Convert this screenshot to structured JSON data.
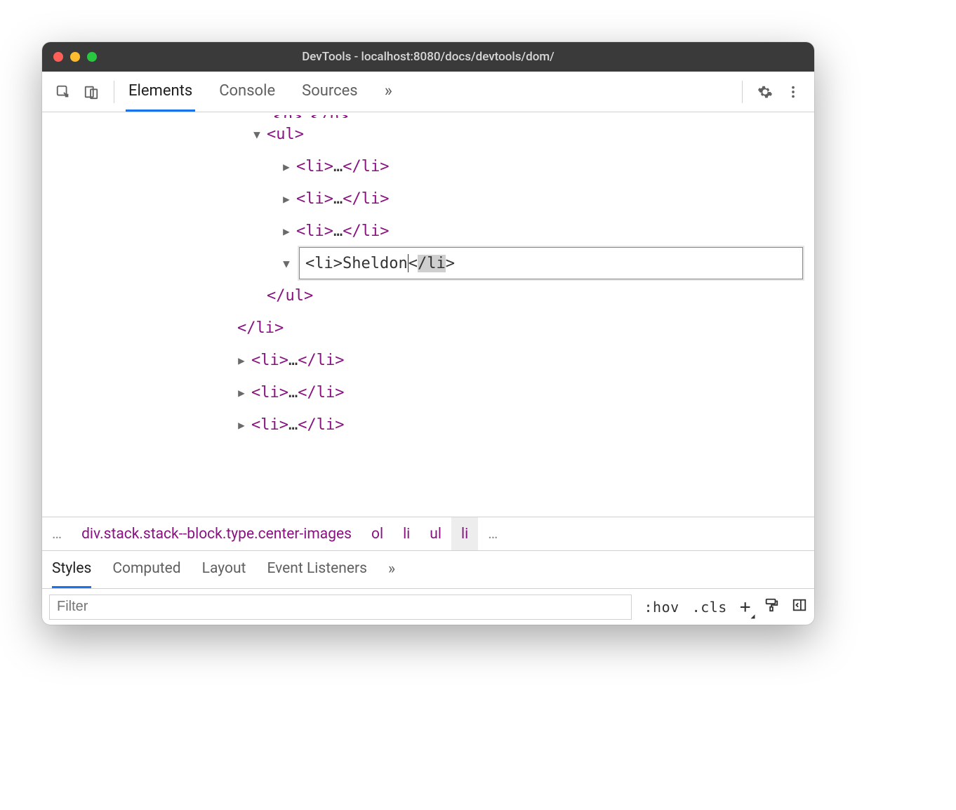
{
  "window": {
    "title": "DevTools - localhost:8080/docs/devtools/dom/"
  },
  "tabs": {
    "elements": "Elements",
    "console": "Console",
    "sources": "Sources"
  },
  "tree": {
    "p_open": "<p>",
    "p_close": "</p>",
    "p_ell": "…",
    "ul_open": "<ul>",
    "li_open": "<li>",
    "li_close": "</li>",
    "li_ell": "…",
    "edit_value": "<li>Sheldon</li>",
    "edit_open": "<li>",
    "edit_text": "Sheldon",
    "edit_close_head": "<",
    "edit_close_slash": "/",
    "edit_close_name": "li",
    "edit_close_tail": ">",
    "ul_close": "</ul>",
    "outer_li_close": "</li>",
    "li4": "<li>",
    "li4c": "</li>",
    "li5": "<li>",
    "li5c": "</li>",
    "li6": "<li>",
    "li6c": "</li>"
  },
  "breadcrumb": {
    "overflow_left": "…",
    "path": "div.stack.stack--block.type.center-images",
    "c1": "ol",
    "c2": "li",
    "c3": "ul",
    "c4": "li",
    "overflow_right": "…"
  },
  "styles_tabs": {
    "styles": "Styles",
    "computed": "Computed",
    "layout": "Layout",
    "event": "Event Listeners"
  },
  "filter": {
    "placeholder": "Filter",
    "hov": ":hov",
    "cls": ".cls"
  }
}
